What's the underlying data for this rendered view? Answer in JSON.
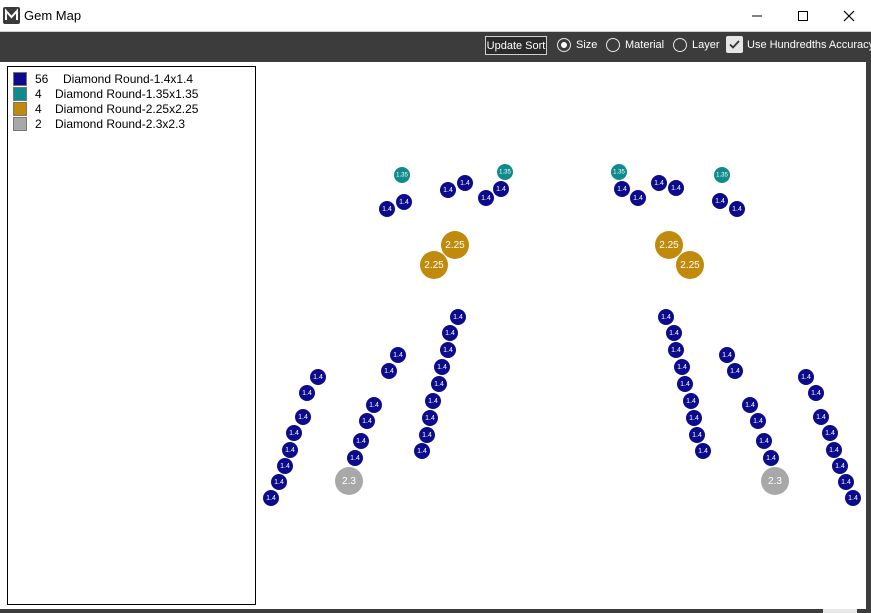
{
  "window": {
    "title": "Gem Map",
    "minimize_icon": "minimize-icon",
    "maximize_icon": "maximize-icon",
    "close_icon": "close-icon"
  },
  "toolbar": {
    "update_sort_label": "Update Sort",
    "sort_options": [
      {
        "label": "Size",
        "selected": true
      },
      {
        "label": "Material",
        "selected": false
      },
      {
        "label": "Layer",
        "selected": false
      }
    ],
    "hundredths_label": "Use Hundredths Accuracy",
    "hundredths_checked": true
  },
  "legend": {
    "items": [
      {
        "count": "56",
        "name": "Diamond Round-1.4x1.4",
        "color": "#0b0b8c"
      },
      {
        "count": "4",
        "name": "Diamond Round-1.35x1.35",
        "color": "#0f8b8d"
      },
      {
        "count": "4",
        "name": "Diamond Round-2.25x2.25",
        "color": "#c08a0c"
      },
      {
        "count": "2",
        "name": "Diamond Round-2.3x2.3",
        "color": "#a8a8a8"
      }
    ]
  },
  "gem_types": {
    "1.4": {
      "label": "1.4",
      "color": "#0b0b8c"
    },
    "1.35": {
      "label": "1.35",
      "color": "#0f8b8d"
    },
    "2.25": {
      "label": "2.25",
      "color": "#c08a0c"
    },
    "2.3": {
      "label": "2.3",
      "color": "#a8a8a8"
    }
  }
}
